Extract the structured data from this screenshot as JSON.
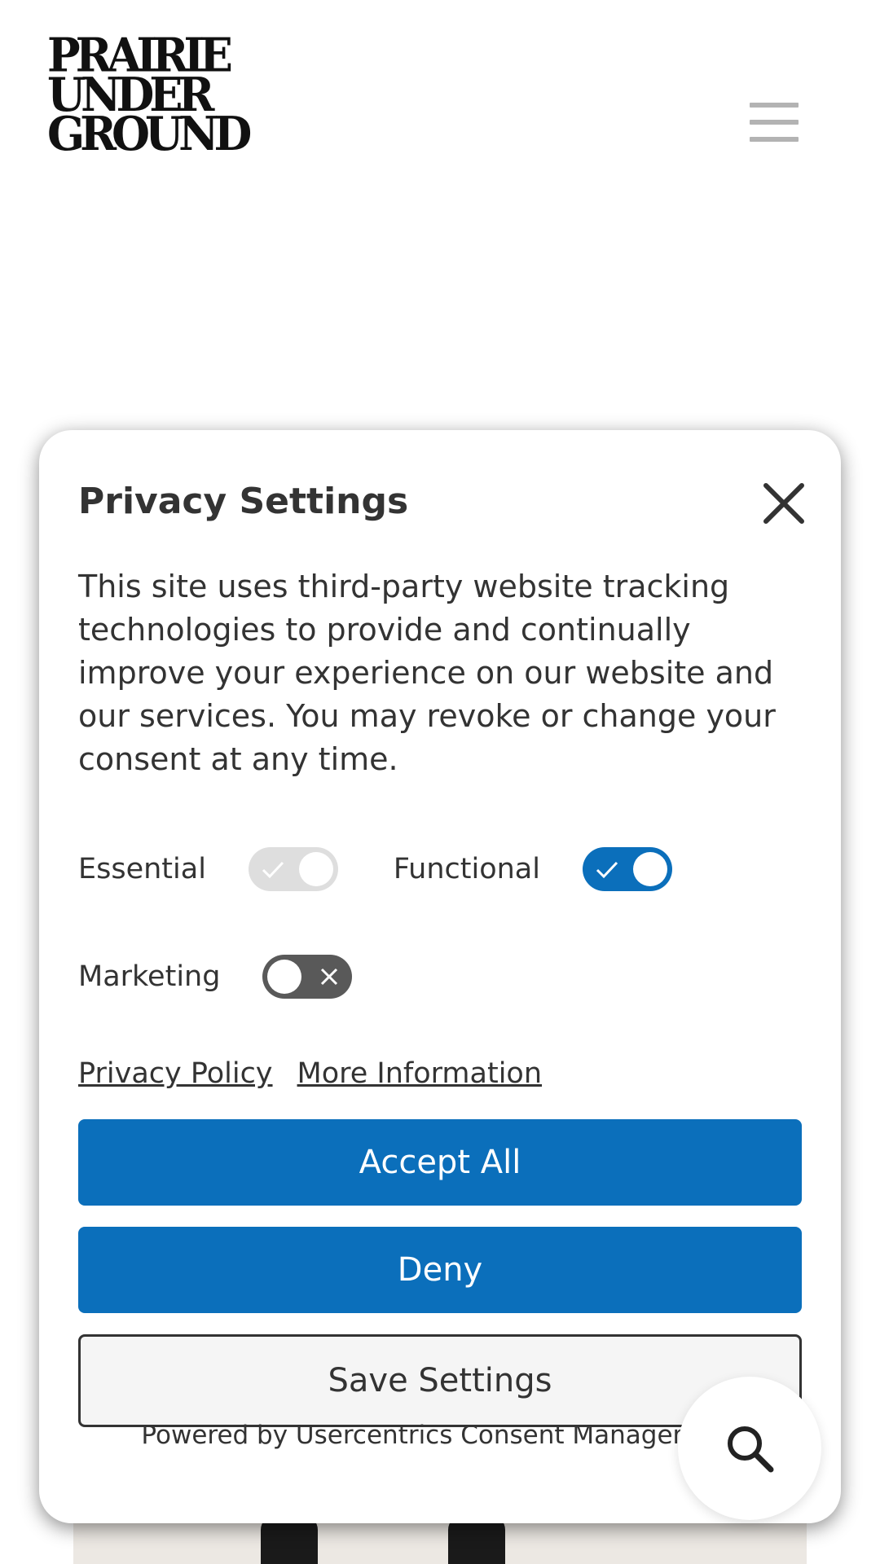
{
  "header": {
    "logo_lines": [
      "PRAIRIE",
      "UNDER",
      "GROUND"
    ],
    "menu_icon": "hamburger-icon"
  },
  "consent": {
    "title": "Privacy Settings",
    "description": "This site uses third-party website tracking technologies to provide and continually improve your experience on our website and our services. You may revoke or change your consent at any time.",
    "toggles": [
      {
        "label": "Essential",
        "state": "on-locked"
      },
      {
        "label": "Functional",
        "state": "on"
      },
      {
        "label": "Marketing",
        "state": "off"
      }
    ],
    "links": {
      "privacy_policy": "Privacy Policy",
      "more_information": "More Information"
    },
    "buttons": {
      "accept_all": "Accept All",
      "deny": "Deny",
      "save_settings": "Save Settings"
    },
    "powered_by": "Powered by Usercentrics Consent Management"
  },
  "colors": {
    "accent": "#0b6fbb",
    "toggle_off": "#595959",
    "toggle_disabled": "#dedede"
  },
  "icons": {
    "close": "close-icon",
    "search": "search-icon"
  }
}
